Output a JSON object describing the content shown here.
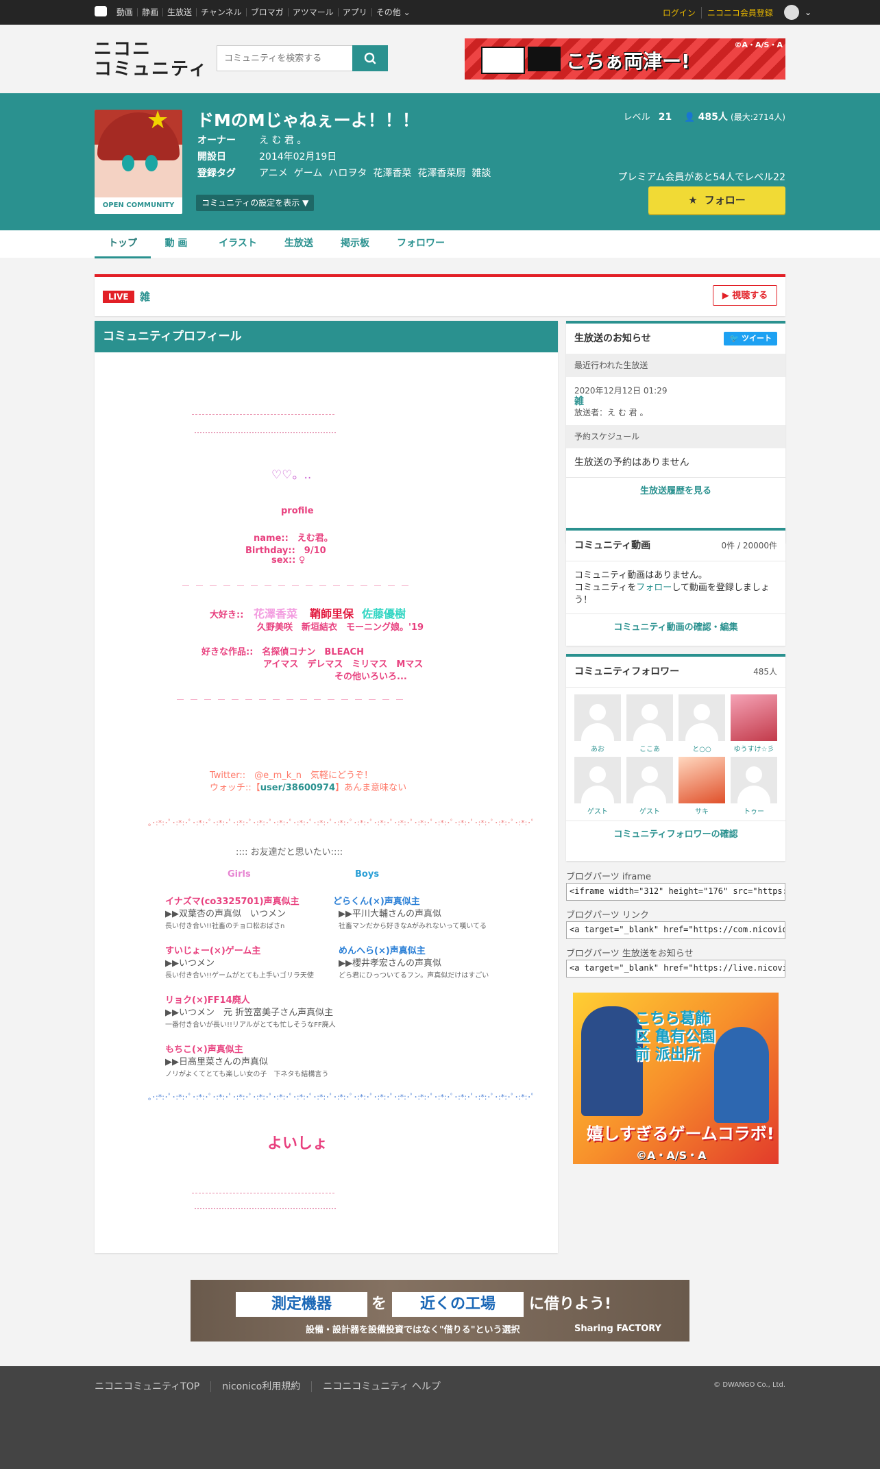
{
  "topbar": {
    "nav": [
      "動画",
      "静画",
      "生放送",
      "チャンネル",
      "ブロマガ",
      "アツマール",
      "アプリ",
      "その他"
    ],
    "login": "ログイン",
    "register": "ニコニコ会員登録"
  },
  "header": {
    "logo_line1": "ニコニ",
    "logo_line2": "コミュニティ",
    "search_placeholder": "コミュニティを検索する",
    "banner_text": "こちぁ両津ー!",
    "banner_copyright": "©A・A/S・A"
  },
  "community": {
    "thumb_label": "OPEN COMMUNITY",
    "title": "ドMのMじゃねぇーよ！！！",
    "owner_label": "オーナー",
    "owner": "え む 君 。",
    "founded_label": "開設日",
    "founded": "2014年02月19日",
    "tags_label": "登録タグ",
    "tags": [
      "アニメ",
      "ゲーム",
      "ハロヲタ",
      "花澤香菜",
      "花澤香菜厨",
      "雑談"
    ],
    "settings_button": "コミュニティの設定を表示 ▼",
    "level_label": "レベル",
    "level": "21",
    "members": "485人",
    "members_max": "(最大:2714人)",
    "premium_text": "プレミアム会員があと54人でレベル22",
    "follow_button": "フォロー"
  },
  "tabs": [
    "トップ",
    "動 画",
    "イラスト",
    "生放送",
    "掲示板",
    "フォロワー"
  ],
  "live": {
    "badge": "LIVE",
    "name": "雑",
    "watch_button": "視聴する"
  },
  "profile": {
    "title": "コミュニティプロフィール",
    "hearts": "♡♡。..",
    "profile_label": "profile",
    "name_line": "name::　えむ君。",
    "birthday_line": "Birthday::　9/10",
    "sex_line": "sex:: ♀",
    "dash_line": "＿　＿　＿　＿　＿　＿　＿　＿　＿　＿　＿　＿　＿　＿　＿　＿　＿",
    "likes_label": "大好き::",
    "likes_1": "花澤香菜",
    "likes_2": "鞘師里保",
    "likes_3": "佐藤優樹",
    "likes_4": "久野美咲　新垣結衣　モーニング娘。'19",
    "works_label": "好きな作品::　名探偵コナン　BLEACH",
    "works_2": "アイマス　デレマス　ミリマス　Mマス",
    "works_3": "その他いろいろ...",
    "twitter_line": "Twitter::　@e_m_k_n　気軽にどうぞ！",
    "watch_line_pre": "ウォッチ::【",
    "watch_user": "user/38600974",
    "watch_line_post": "】あんま意味ない",
    "sparkle": "｡･:*:･ﾟ･:*:･ﾟ･:*:･ﾟ･:*:･ﾟ･:*:･ﾟ･:*:･ﾟ･:*:･ﾟ･:*:･ﾟ･:*:･ﾟ･:*:･ﾟ･:*:･ﾟ･:*:･ﾟ･:*:･ﾟ･:*:･ﾟ･:*:･ﾟ･:*:･ﾟ･:*:･ﾟ･:*:･ﾟ･:*:･ﾟ",
    "friends_title": ":::: お友達だと思いたい::::",
    "girls_label": "Girls",
    "boys_label": "Boys",
    "g1_name": "イナズマ(co3325701)声真似主",
    "g1_desc": "▶▶双葉杏の声真似　いつメン",
    "g1_note": "長い付き合い!!社畜のチョロ松おばさn",
    "b1_name": "どらくん(×)声真似主",
    "b1_desc": "▶▶平川大輔さんの声真似",
    "b1_note": "社畜マンだから好きなAがみれないって嘆いてる",
    "g2_name": "すいじょー(×)ゲーム主",
    "g2_desc": "▶▶いつメン",
    "g2_note": "長い付き合い!!ゲームがとても上手いゴリラ天使",
    "b2_name": "めんへら(×)声真似主",
    "b2_desc": "▶▶櫻井孝宏さんの声真似",
    "b2_note": "どら君にひっついてるフン。声真似だけはすごい",
    "g3_name": "リョク(×)FF14廃人",
    "g3_desc": "▶▶いつメン　元 折笠富美子さん声真似主",
    "g3_note": "一番付き合いが長い!!リアルがとても忙しそうなFF廃人",
    "g4_name": "もちこ(×)声真似主",
    "g4_desc": "▶▶日高里菜さんの声真似",
    "g4_note": "ノリがよくてとても楽しい女の子　下ネタも結構言う",
    "closing": "よいしょ"
  },
  "live_notice": {
    "title": "生放送のお知らせ",
    "tweet": "ツイート",
    "recent_label": "最近行われた生放送",
    "recent_date": "2020年12月12日 01:29",
    "recent_name": "雑",
    "recent_broadcaster": "放送者：え む 君 。",
    "schedule_label": "予約スケジュール",
    "schedule_none": "生放送の予約はありません",
    "history_link": "生放送履歴を見る"
  },
  "videos": {
    "title": "コミュニティ動画",
    "count": "0件 / 20000件",
    "empty_1": "コミュニティ動画はありません。",
    "empty_2_pre": "コミュニティを",
    "empty_2_link": "フォロー",
    "empty_2_post": "して動画を登録しましょう！",
    "manage_link": "コミュニティ動画の確認・編集"
  },
  "followers": {
    "title": "コミュニティフォロワー",
    "count": "485人",
    "items": [
      {
        "name": "あお"
      },
      {
        "name": "ここあ"
      },
      {
        "name": "と○○"
      },
      {
        "name": "ゆうすけ☆彡"
      },
      {
        "name": "ゲスト"
      },
      {
        "name": "ゲスト"
      },
      {
        "name": "サキ"
      },
      {
        "name": "トゥー"
      }
    ],
    "check_link": "コミュニティフォロワーの確認"
  },
  "blog_parts": {
    "iframe_label": "ブログパーツ iframe",
    "iframe_value": "<iframe width=\"312\" height=\"176\" src=\"https://com.",
    "link_label": "ブログパーツ リンク",
    "link_value": "<a target=\"_blank\" href=\"https://com.nicovideo.jp/",
    "live_label": "ブログパーツ 生放送をお知らせ",
    "live_value": "<a target=\"_blank\" href=\"https://live.nicovideo.jp/"
  },
  "ad_side": {
    "title": "こちら葛飾区 亀有公園前 派出所",
    "tagline": "嬉しすぎるゲームコラボ!",
    "copyright": "©A・A/S・A"
  },
  "ad_bottom": {
    "word1": "測定機器",
    "particle": "を",
    "word2": "近くの工場",
    "ending": "に借りよう!",
    "sub": "設備・設計器を設備投資ではなく\"借りる\"という選択",
    "brand": "Sharing FACTORY"
  },
  "footer": {
    "links": [
      "ニコニコミュニティTOP",
      "niconico利用規約",
      "ニコニコミュニティ ヘルプ"
    ],
    "copyright": "© DWANGO Co., Ltd."
  }
}
